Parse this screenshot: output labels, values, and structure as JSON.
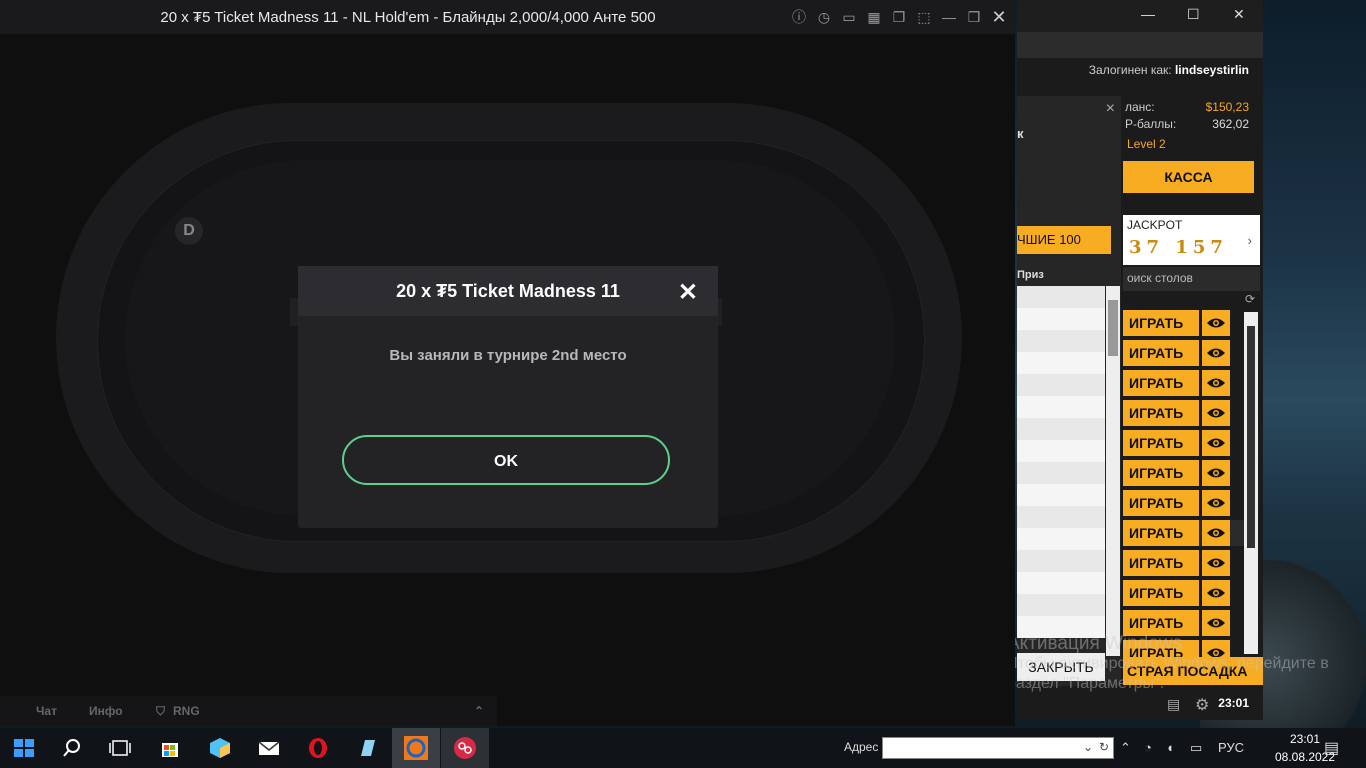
{
  "poker_window": {
    "title": "20 x ₮5 Ticket Madness 11 - NL Hold'em - Блайнды 2,000/4,000 Анте 500",
    "dealer_button": "D",
    "bottom_tabs": [
      "Чат",
      "Инфо",
      "RNG"
    ]
  },
  "modal": {
    "title": "20 x ₮5 Ticket Madness 11",
    "message": "Вы заняли в турнире 2nd место",
    "ok_label": "OK"
  },
  "lobby": {
    "logged_in_label": "Залогинен как:",
    "username": "lindseystirlin",
    "balance_label": "ланс:",
    "balance_value": "$150,23",
    "points_label": "Р-баллы:",
    "points_value": "362,02",
    "level": "Level 2",
    "kassa_label": "КАССА",
    "jackpot_label": "JACKPOT",
    "jackpot_digits": "37 157",
    "search_tables": "оиск столов",
    "play_label": "ИГРАТЬ",
    "play_rows": 12,
    "fast_seat_label": "СТРАЯ ПОСАДКА",
    "clock": "23:01"
  },
  "tournament_info": {
    "partial_header": "к",
    "best100": "ЧШИЕ 100",
    "prize_header": "Приз",
    "close_label": "ЗАКРЫТЬ"
  },
  "watermark": {
    "line1": "Активация Windows",
    "line2": "Чтобы активировать Windows, перейдите в",
    "line3": "раздел \"Параметры\"."
  },
  "taskbar": {
    "address_label": "Адрес",
    "language": "РУС",
    "time": "23:01",
    "date": "08.08.2022"
  },
  "colors": {
    "accent_orange": "#f7ac22",
    "ok_border": "#5fcf8e"
  }
}
